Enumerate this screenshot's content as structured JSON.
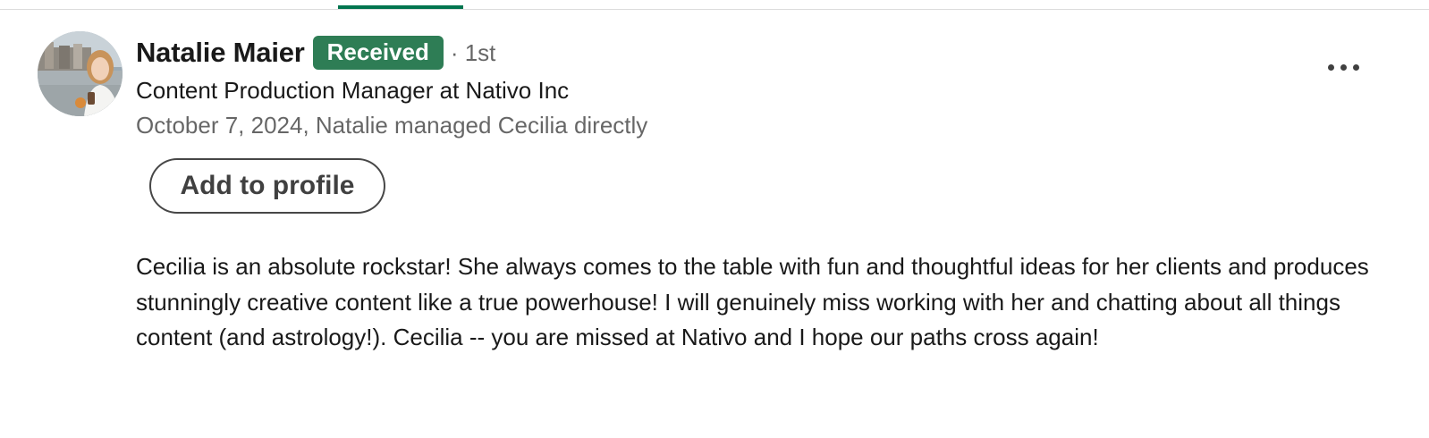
{
  "recommendation": {
    "recommender_name": "Natalie Maier",
    "status_badge": "Received",
    "connection_degree": "· 1st",
    "headline": "Content Production Manager at Nativo Inc",
    "meta": "October 7, 2024, Natalie managed Cecilia directly",
    "add_button_label": "Add to profile",
    "more_options_icon": "more-horizontal-icon",
    "text": "Cecilia is an absolute rockstar! She always comes to the table with fun and thoughtful ideas for her clients and produces stunningly creative content like a true powerhouse! I will genuinely miss working with her and chatting about all things content (and astrology!). Cecilia -- you are missed at Nativo and I hope our paths cross again!"
  },
  "colors": {
    "badge_background": "#2e7d55",
    "active_tab_indicator": "#01754f",
    "secondary_text": "#666666"
  }
}
